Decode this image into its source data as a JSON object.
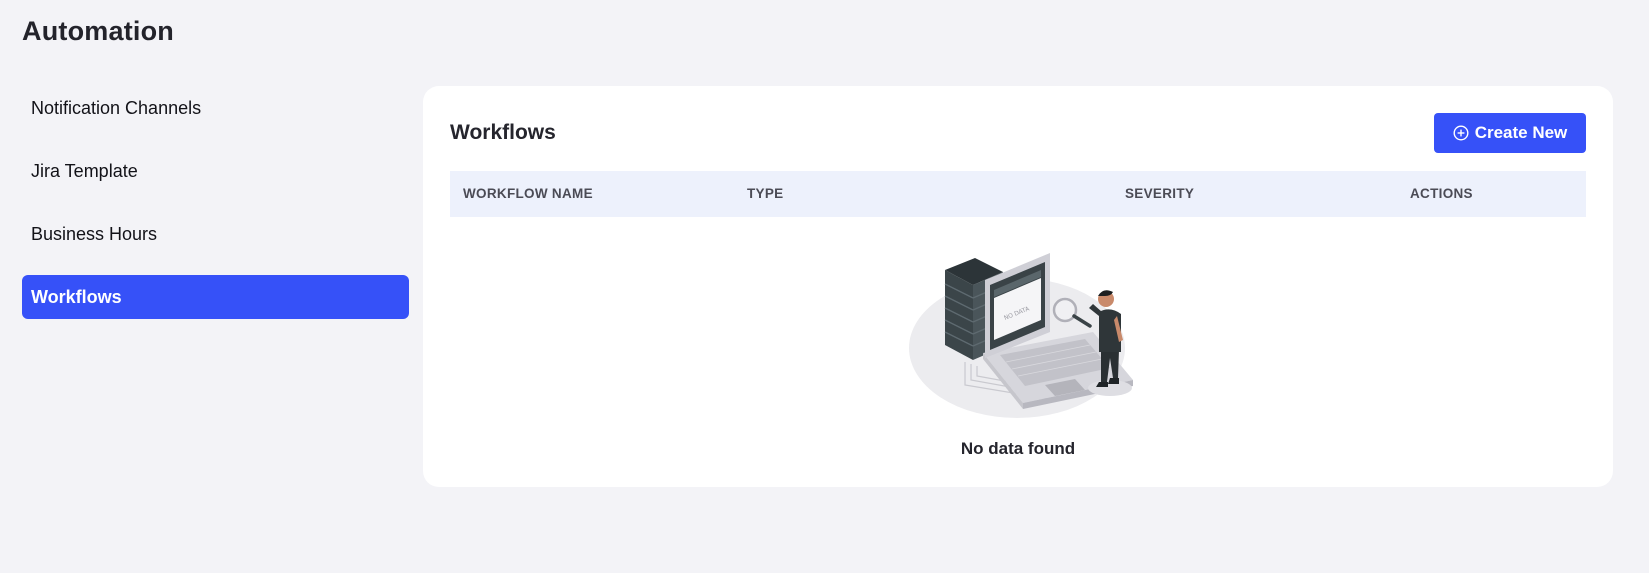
{
  "page": {
    "title": "Automation"
  },
  "sidebar": {
    "items": [
      {
        "label": "Notification Channels",
        "active": false
      },
      {
        "label": "Jira Template",
        "active": false
      },
      {
        "label": "Business Hours",
        "active": false
      },
      {
        "label": "Workflows",
        "active": true
      }
    ]
  },
  "panel": {
    "title": "Workflows",
    "create_button": {
      "label": "Create New",
      "icon": "plus-circle-icon"
    },
    "table": {
      "columns": [
        "WORKFLOW NAME",
        "TYPE",
        "SEVERITY",
        "ACTIONS"
      ],
      "rows": []
    },
    "empty_state": {
      "illustration": "no-data-illustration",
      "screen_label": "NO DATA",
      "message": "No data found"
    }
  },
  "colors": {
    "accent": "#3651f8",
    "background": "#f3f3f7",
    "table_header": "#edf1fc"
  }
}
